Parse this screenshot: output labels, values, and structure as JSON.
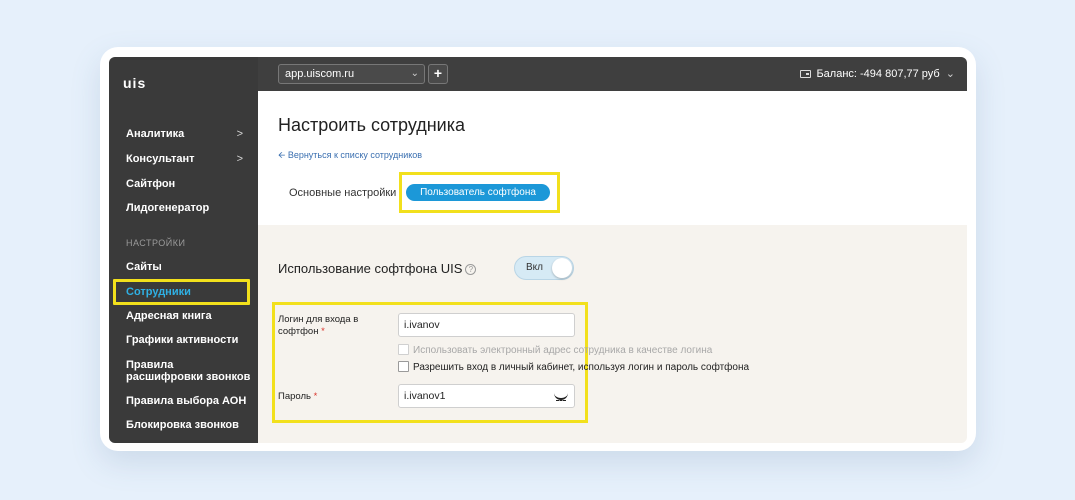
{
  "logo": "uis",
  "sidebar": {
    "items": [
      {
        "label": "Аналитика",
        "chevron": ">"
      },
      {
        "label": "Консультант",
        "chevron": ">"
      },
      {
        "label": "Сайтфон"
      },
      {
        "label": "Лидогенератор"
      }
    ],
    "section_label": "НАСТРОЙКИ",
    "settings_items": [
      {
        "label": "Сайты"
      },
      {
        "label": "Сотрудники",
        "active": true
      },
      {
        "label": "Адресная книга"
      },
      {
        "label": "Графики активности"
      },
      {
        "label_line1": "Правила",
        "label_line2": "расшифровки звонков"
      },
      {
        "label": "Правила выбора АОН"
      },
      {
        "label": "Блокировка звонков"
      }
    ]
  },
  "topbar": {
    "site": "app.uiscom.ru",
    "plus": "+",
    "balance": "Баланс: -494 807,77 руб"
  },
  "header": {
    "title": "Настроить сотрудника",
    "back_link": "Вернуться к списку сотрудников",
    "tabs": [
      {
        "label": "Основные настройки",
        "active": false
      },
      {
        "label": "Пользователь софтфона",
        "active": true
      }
    ]
  },
  "softphone": {
    "section_title": "Использование софтфона UIS",
    "help": "?",
    "toggle_label": "Вкл",
    "toggle_on": true,
    "login_label_line1": "Логин для входа в",
    "login_label_line2": "софтфон",
    "required_mark": "*",
    "login_value": "i.ivanov",
    "use_email_checkbox": "Использовать электронный адрес сотрудника в качестве логина",
    "allow_cabinet_checkbox": "Разрешить вход в личный кабинет, используя логин и пароль софтфона",
    "password_label": "Пароль",
    "password_value": "i.ivanov1"
  },
  "colors": {
    "sidebar_bg": "#3a3a3a",
    "accent": "#1c98d8",
    "highlight": "#f2e01c",
    "active_nav": "#2fb0e4"
  }
}
